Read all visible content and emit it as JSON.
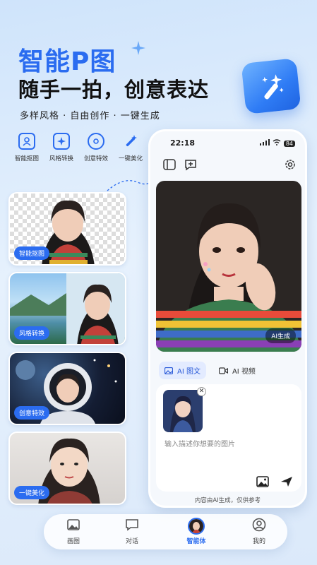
{
  "hero": {
    "title": "智能P图",
    "subtitle": "随手一拍，创意表达",
    "tagline": "多样风格 · 自由创作 · 一键生成"
  },
  "features": [
    {
      "label": "智能抠图",
      "icon": "cutout-icon"
    },
    {
      "label": "风格转换",
      "icon": "style-transfer-icon"
    },
    {
      "label": "创意特效",
      "icon": "effects-gear-icon"
    },
    {
      "label": "一键美化",
      "icon": "magic-wand-icon"
    }
  ],
  "cards": [
    {
      "tag": "智能抠图"
    },
    {
      "tag": "风格转换"
    },
    {
      "tag": "创意特效"
    },
    {
      "tag": "一键美化"
    }
  ],
  "phone": {
    "time": "22:18",
    "battery": "84",
    "ai_badge": "AI生成",
    "tabs": [
      {
        "label": "AI 图文",
        "active": true
      },
      {
        "label": "AI 视频",
        "active": false
      }
    ],
    "prompt_placeholder": "输入描述你想要的图片",
    "disclaimer": "内容由AI生成，仅供参考"
  },
  "nav": {
    "items": [
      {
        "label": "画图"
      },
      {
        "label": "对话"
      },
      {
        "label": "智能体"
      },
      {
        "label": "我的"
      }
    ]
  },
  "colors": {
    "accent": "#2b6cf0",
    "background": "#dbe9fa"
  }
}
